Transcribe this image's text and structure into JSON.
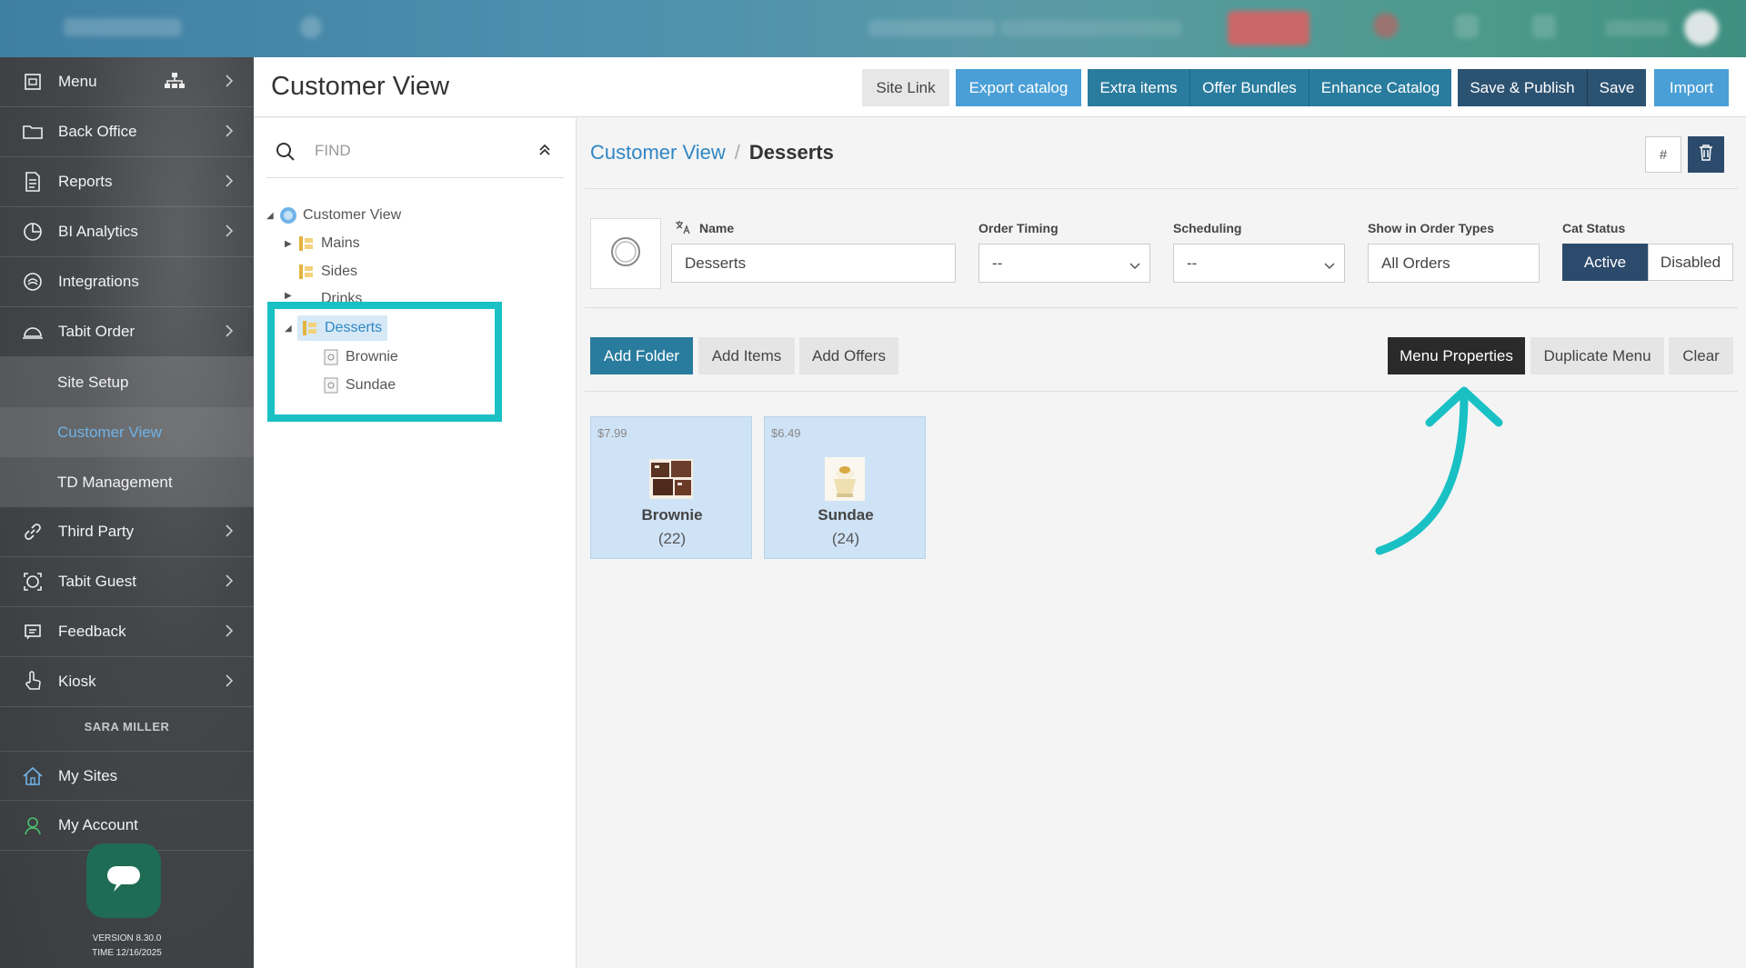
{
  "sidebar": {
    "items": [
      {
        "label": "Menu"
      },
      {
        "label": "Back Office"
      },
      {
        "label": "Reports"
      },
      {
        "label": "BI Analytics"
      },
      {
        "label": "Integrations"
      },
      {
        "label": "Tabit Order"
      },
      {
        "label": "Third Party"
      },
      {
        "label": "Tabit Guest"
      },
      {
        "label": "Feedback"
      },
      {
        "label": "Kiosk"
      },
      {
        "label": "My Sites"
      },
      {
        "label": "My Account"
      }
    ],
    "subitems": [
      {
        "label": "Site Setup"
      },
      {
        "label": "Customer View"
      },
      {
        "label": "TD Management"
      }
    ],
    "user_name": "SARA MILLER",
    "version": "VERSION 8.30.0",
    "time": "TIME 12/16/2025"
  },
  "header": {
    "title": "Customer View",
    "buttons": {
      "site_link": "Site Link",
      "export_catalog": "Export catalog",
      "extra_items": "Extra items",
      "offer_bundles": "Offer Bundles",
      "enhance_catalog": "Enhance Catalog",
      "save_publish": "Save & Publish",
      "save": "Save",
      "import": "Import"
    }
  },
  "tree": {
    "find_placeholder": "FIND",
    "root": "Customer View",
    "nodes": [
      "Mains",
      "Sides",
      "Drinks",
      "Desserts"
    ],
    "children": [
      "Brownie",
      "Sundae"
    ]
  },
  "content": {
    "breadcrumb": {
      "root": "Customer View",
      "current": "Desserts"
    },
    "hash_label": "#",
    "fields": {
      "name_label": "Name",
      "name_value": "Desserts",
      "order_timing_label": "Order Timing",
      "order_timing_value": "--",
      "scheduling_label": "Scheduling",
      "scheduling_value": "--",
      "order_types_label": "Show in Order Types",
      "order_types_value": "All Orders",
      "cat_status_label": "Cat Status",
      "status_active": "Active",
      "status_disabled": "Disabled"
    },
    "actions": {
      "add_folder": "Add Folder",
      "add_items": "Add Items",
      "add_offers": "Add Offers",
      "menu_properties": "Menu Properties",
      "duplicate_menu": "Duplicate Menu",
      "clear": "Clear"
    },
    "tiles": [
      {
        "price": "$7.99",
        "name": "Brownie",
        "count": "(22)"
      },
      {
        "price": "$6.49",
        "name": "Sundae",
        "count": "(24)"
      }
    ]
  },
  "colors": {
    "highlight": "#19c0c4",
    "arrow": "#19c0c4",
    "accent_blue": "#4a9fd6",
    "teal": "#2a7c9e",
    "navy": "#2c5272",
    "active_status": "#2c4a6b"
  }
}
